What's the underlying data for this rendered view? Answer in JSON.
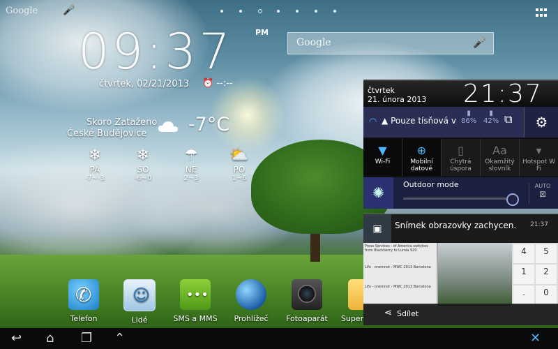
{
  "status_bar": {
    "google_label": "Google",
    "mic_icon": "microphone-icon",
    "page_dots": 5,
    "active_page": 3,
    "apps_icon": "apps-grid-icon"
  },
  "clock_widget": {
    "time": "09:37",
    "ampm": "PM",
    "date": "čtvrtek, 02/21/2013",
    "alarm": "--:--"
  },
  "search": {
    "placeholder": "Google"
  },
  "weather": {
    "condition": "Skoro Zataženo",
    "city": "České Budějovice",
    "temperature": "-7°C",
    "forecast": [
      {
        "day": "PÁ",
        "temps": "-7~-3",
        "icon": "snow-icon"
      },
      {
        "day": "SO",
        "temps": "-6~0",
        "icon": "snow-icon"
      },
      {
        "day": "NE",
        "temps": "2~3",
        "icon": "rain-snow-icon"
      },
      {
        "day": "PO",
        "temps": "1~6",
        "icon": "partly-cloudy-icon"
      }
    ]
  },
  "dock": [
    {
      "label": "Telefon",
      "icon": "phone-icon"
    },
    {
      "label": "Lidé",
      "icon": "contacts-icon"
    },
    {
      "label": "SMS a MMS",
      "icon": "sms-icon"
    },
    {
      "label": "Prohlížeč",
      "icon": "browser-icon"
    },
    {
      "label": "Fotoaparát",
      "icon": "camera-icon"
    },
    {
      "label": "Super",
      "icon": "notes-icon"
    }
  ],
  "quick_settings": {
    "day": "čtvrtek",
    "date": "21. února 2013",
    "time": "21:37",
    "network": "Pouze tísňová v",
    "battery1": "86%",
    "battery2": "42%",
    "tiles": [
      {
        "label": "Wi-Fi",
        "icon": "wifi-icon",
        "active": true
      },
      {
        "label": "Mobilní datové",
        "icon": "globe-icon",
        "active": true
      },
      {
        "label": "Chytrá úspora",
        "icon": "battery-saver-icon",
        "active": false
      },
      {
        "label": "Okamžitý slovník",
        "icon": "dictionary-icon",
        "active": false
      },
      {
        "label": "Hotspot W Fi",
        "icon": "hotspot-icon",
        "active": false
      }
    ],
    "outdoor_mode": "Outdoor mode",
    "brightness": 0.9,
    "auto_label": "AUTO"
  },
  "notification": {
    "title": "Snímek obrazovky zachycen.",
    "time": "21:37",
    "share": "Sdílet",
    "preview_rows": [
      "Press Services · of America switches from Blackberry to Lumia 920",
      "Lifo · onemnot - MWC 2013 Barcelona",
      "Lifo · onemnot - MWC 2013 Barcelona"
    ],
    "keypad": [
      "4",
      "5",
      "1",
      "2",
      ".",
      "0"
    ]
  }
}
